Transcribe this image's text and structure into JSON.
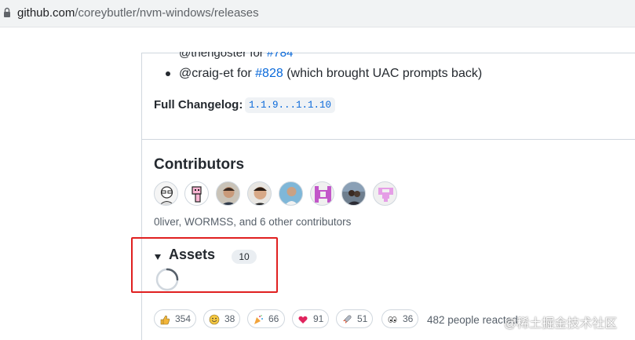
{
  "browser": {
    "url_host": "github.com",
    "url_path": "/coreybutler/nvm-windows/releases"
  },
  "release_notes": {
    "cut_off_line_prefix": "@thehgoster for ",
    "cut_off_line_link": "#784",
    "bullet_user": "@craig-et",
    "bullet_for": " for ",
    "bullet_link": "#828",
    "bullet_rest": " (which brought UAC prompts back)",
    "changelog_label": "Full Changelog:",
    "changelog_range": "1.1.9...1.1.10"
  },
  "contributors": {
    "title": "Contributors",
    "avatars": [
      "avatar-1",
      "avatar-2",
      "avatar-3",
      "avatar-4",
      "avatar-5",
      "avatar-6",
      "avatar-7",
      "avatar-8"
    ],
    "summary": "0liver, WORMSS, and 6 other contributors"
  },
  "assets": {
    "title": "Assets",
    "count": "10"
  },
  "reactions": {
    "items": [
      {
        "icon": "thumbs-up-icon",
        "count": "354"
      },
      {
        "icon": "smile-icon",
        "count": "38"
      },
      {
        "icon": "tada-icon",
        "count": "66"
      },
      {
        "icon": "heart-icon",
        "count": "91"
      },
      {
        "icon": "rocket-icon",
        "count": "51"
      },
      {
        "icon": "eyes-icon",
        "count": "36"
      }
    ],
    "summary": "482 people reacted"
  },
  "watermark": "@稀土掘金技术社区",
  "colors": {
    "link": "#0969da",
    "highlight_box": "#e02020"
  }
}
